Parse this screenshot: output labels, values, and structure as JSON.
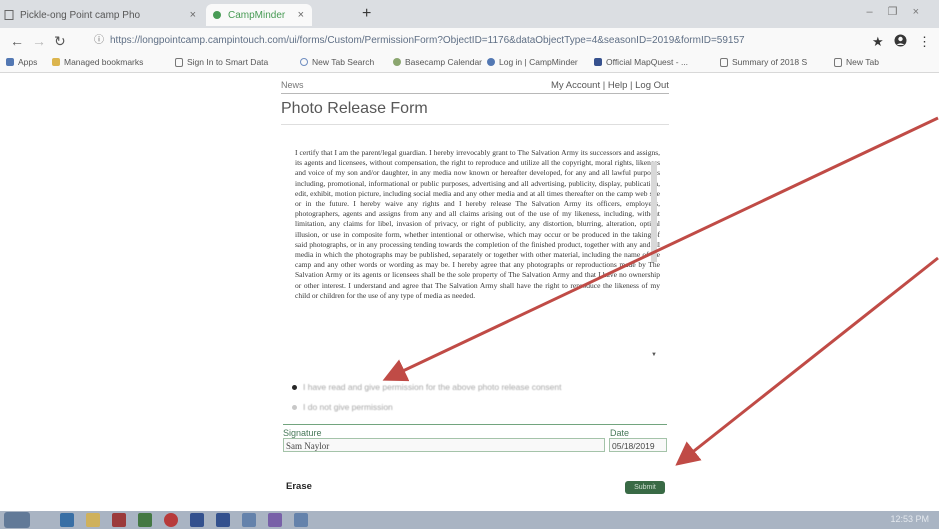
{
  "browser": {
    "tabs": [
      {
        "label": "Pickle-ong Point camp Pho"
      },
      {
        "label": "CampMinder"
      }
    ],
    "new_tab_glyph": "+",
    "address": {
      "info_glyph": "ⓘ",
      "url": "https://longpointcamp.campintouch.com/ui/forms/Custom/PermissionForm?ObjectID=1176&dataObjectType=4&seasonID=2019&formID=59157"
    },
    "toolbar_icons": [
      "star-icon",
      "account-icon",
      "menu-icon"
    ],
    "bookmarks": [
      {
        "label": "Apps",
        "color": "#4a78c2"
      },
      {
        "label": "Managed bookmarks",
        "color": "#e8b838"
      },
      {
        "label": "Sign In to Smart Data",
        "color": "#777777"
      },
      {
        "label": "New Tab Search",
        "color": "#6a8fcf"
      },
      {
        "label": "Basecamp Calendar",
        "color": "#88aa66"
      },
      {
        "label": "Log in | CampMinder",
        "color": "#4a78c2"
      },
      {
        "label": "Official MapQuest - ...",
        "color": "#2e4f9a"
      },
      {
        "label": "Summary of 2018 S",
        "color": "#777777"
      },
      {
        "label": "New Tab",
        "color": "#777777"
      }
    ]
  },
  "page": {
    "partial_top_text": "News",
    "account_links": "My Account | Help | Log Out",
    "form_title": "Photo Release Form",
    "release_text": "I certify that I am the parent/legal guardian. I hereby irrevocably grant to The Salvation Army its successors and assigns, its agents and licensees, without compensation, the right to reproduce and utilize all the copyright, moral rights, likeness and voice of my son and/or daughter, in any media now known or hereafter developed, for any and all lawful purposes including, promotional, informational or public purposes, advertising and all advertising, publicity, display, publication, edit, exhibit, motion picture, including social media and any other media and at all times thereafter on the camp web site or in the future. I hereby waive any rights and I hereby release The Salvation Army its officers, employees, photographers, agents and assigns from any and all claims arising out of the use of my likeness, including, without limitation, any claims for libel, invasion of privacy, or right of publicity, any distortion, blurring, alteration, optical illusion, or use in composite form, whether intentional or otherwise, which may occur or be produced in the taking of said photographs, or in any processing tending towards the completion of the finished product, together with any and all media in which the photographs may be published, separately or together with other material, including the name of the camp and any other words or wording as may be. I hereby agree that any photographs or reproductions made by The Salvation Army or its agents or licensees shall be the sole property of The Salvation Army and that I have no ownership or other interest. I understand and agree that The Salvation Army shall have the right to reproduce the likeness of my child or children for the use of any type of media as needed.",
    "options": [
      {
        "label": "I have read and give permission for the above photo release consent",
        "selected": true
      },
      {
        "label": "I do not give permission",
        "selected": false
      }
    ],
    "signature_label": "Signature",
    "date_label": "Date",
    "signature_value": "Sam Naylor",
    "date_value": "05/18/2019",
    "erase_label": "Erase",
    "submit_label": "Submit"
  },
  "taskbar": {
    "clock": "12:53 PM"
  },
  "colors": {
    "accent_green": "#2f6b3d",
    "arrow_red": "#d4443d",
    "field_border": "#a2c8a8"
  }
}
